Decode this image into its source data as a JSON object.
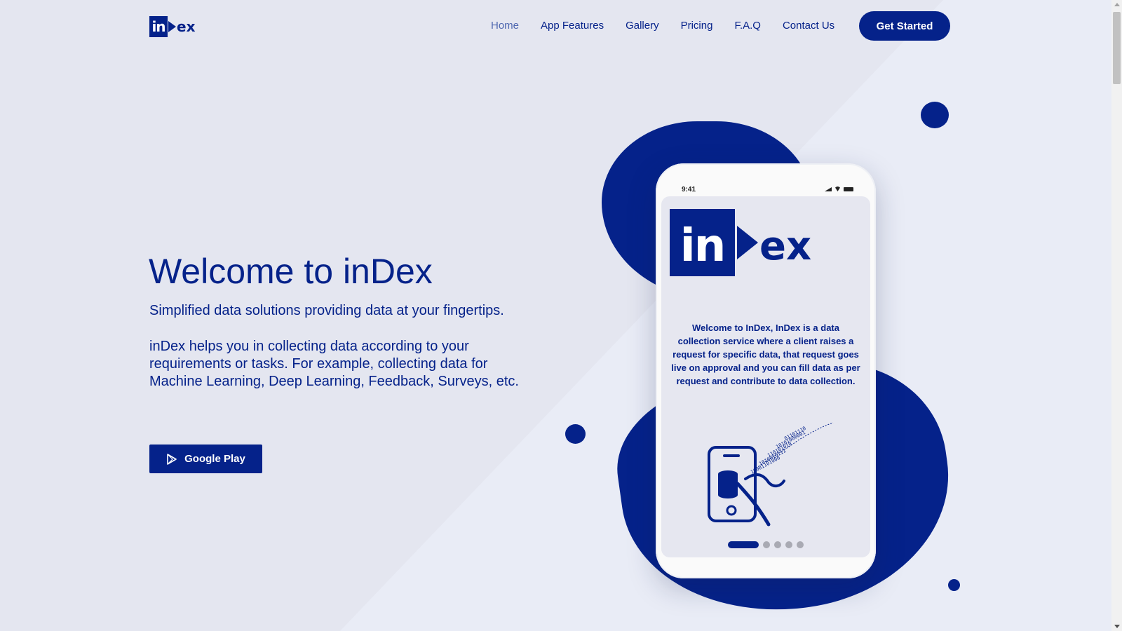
{
  "nav": {
    "logo_in": "in",
    "logo_rest": "ex",
    "items": [
      {
        "label": "Home",
        "active": true
      },
      {
        "label": "App Features"
      },
      {
        "label": "Gallery"
      },
      {
        "label": "Pricing"
      },
      {
        "label": "F.A.Q"
      },
      {
        "label": "Contact Us"
      }
    ],
    "cta_label": "Get Started"
  },
  "hero": {
    "title": "Welcome to inDex",
    "subtitle": "Simplified data solutions providing data at your fingertips.",
    "description": "inDex helps you in collecting data according to your requirements or tasks. For example, collecting data for Machine Learning, Deep Learning, Feedback, Surveys, etc.",
    "store_button": "Google Play",
    "store_icon": "play-store-icon"
  },
  "phone": {
    "status_time": "9:41",
    "logo_in": "in",
    "logo_rest": "ex",
    "screen_text": "Welcome to InDex, InDex is a data collection service where a client raises a request for specific data, that request goes live on approval and you can fill data as per request and contribute to data collection.",
    "binary_lines": [
      "01101110",
      "10101000001",
      "110101010",
      "1010010111",
      "10001101000"
    ],
    "pager": {
      "total": 5,
      "active_index": 0
    }
  },
  "colors": {
    "brand": "#05228a",
    "background": "#e4e6f0",
    "nav_active": "#4f68b0"
  }
}
